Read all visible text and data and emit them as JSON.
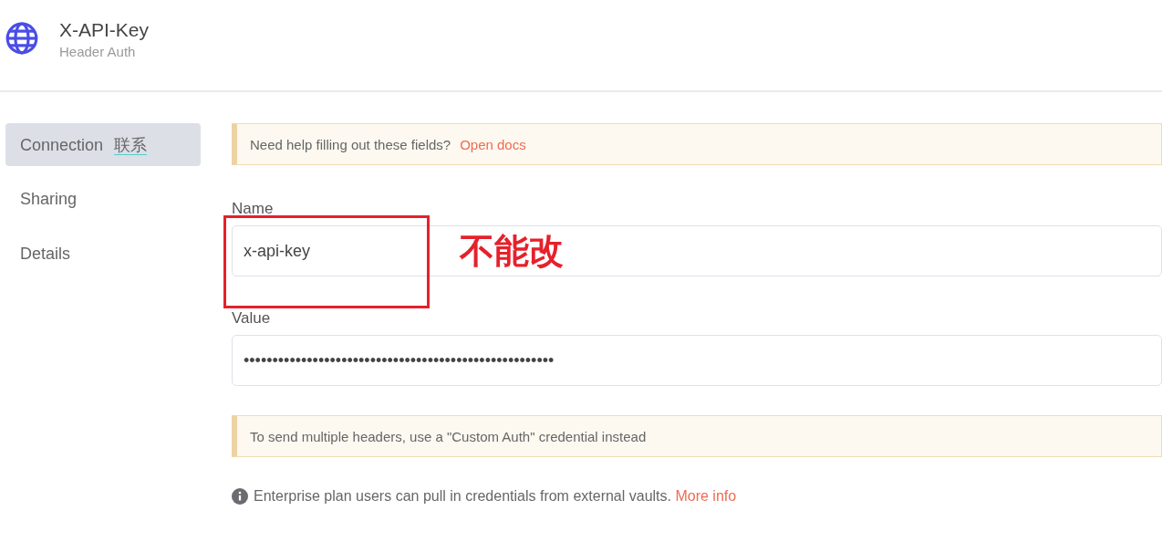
{
  "header": {
    "title": "X-API-Key",
    "subtitle": "Header Auth"
  },
  "sidebar": {
    "items": [
      {
        "label": "Connection",
        "translation": "联系",
        "selected": true
      },
      {
        "label": "Sharing",
        "selected": false
      },
      {
        "label": "Details",
        "selected": false
      }
    ]
  },
  "help_notice": {
    "text": "Need help filling out these fields?",
    "link": "Open docs"
  },
  "fields": [
    {
      "label": "Name",
      "value": "x-api-key"
    },
    {
      "label": "Value",
      "value": "••••••••••••••••••••••••••••••••••••••••••••••••••••••"
    }
  ],
  "multi_header_notice": {
    "text": "To send multiple headers, use a \"Custom Auth\" credential instead"
  },
  "info": {
    "text": "Enterprise plan users can pull in credentials from external vaults.",
    "link": "More info"
  },
  "annotation": {
    "text": "不能改"
  }
}
